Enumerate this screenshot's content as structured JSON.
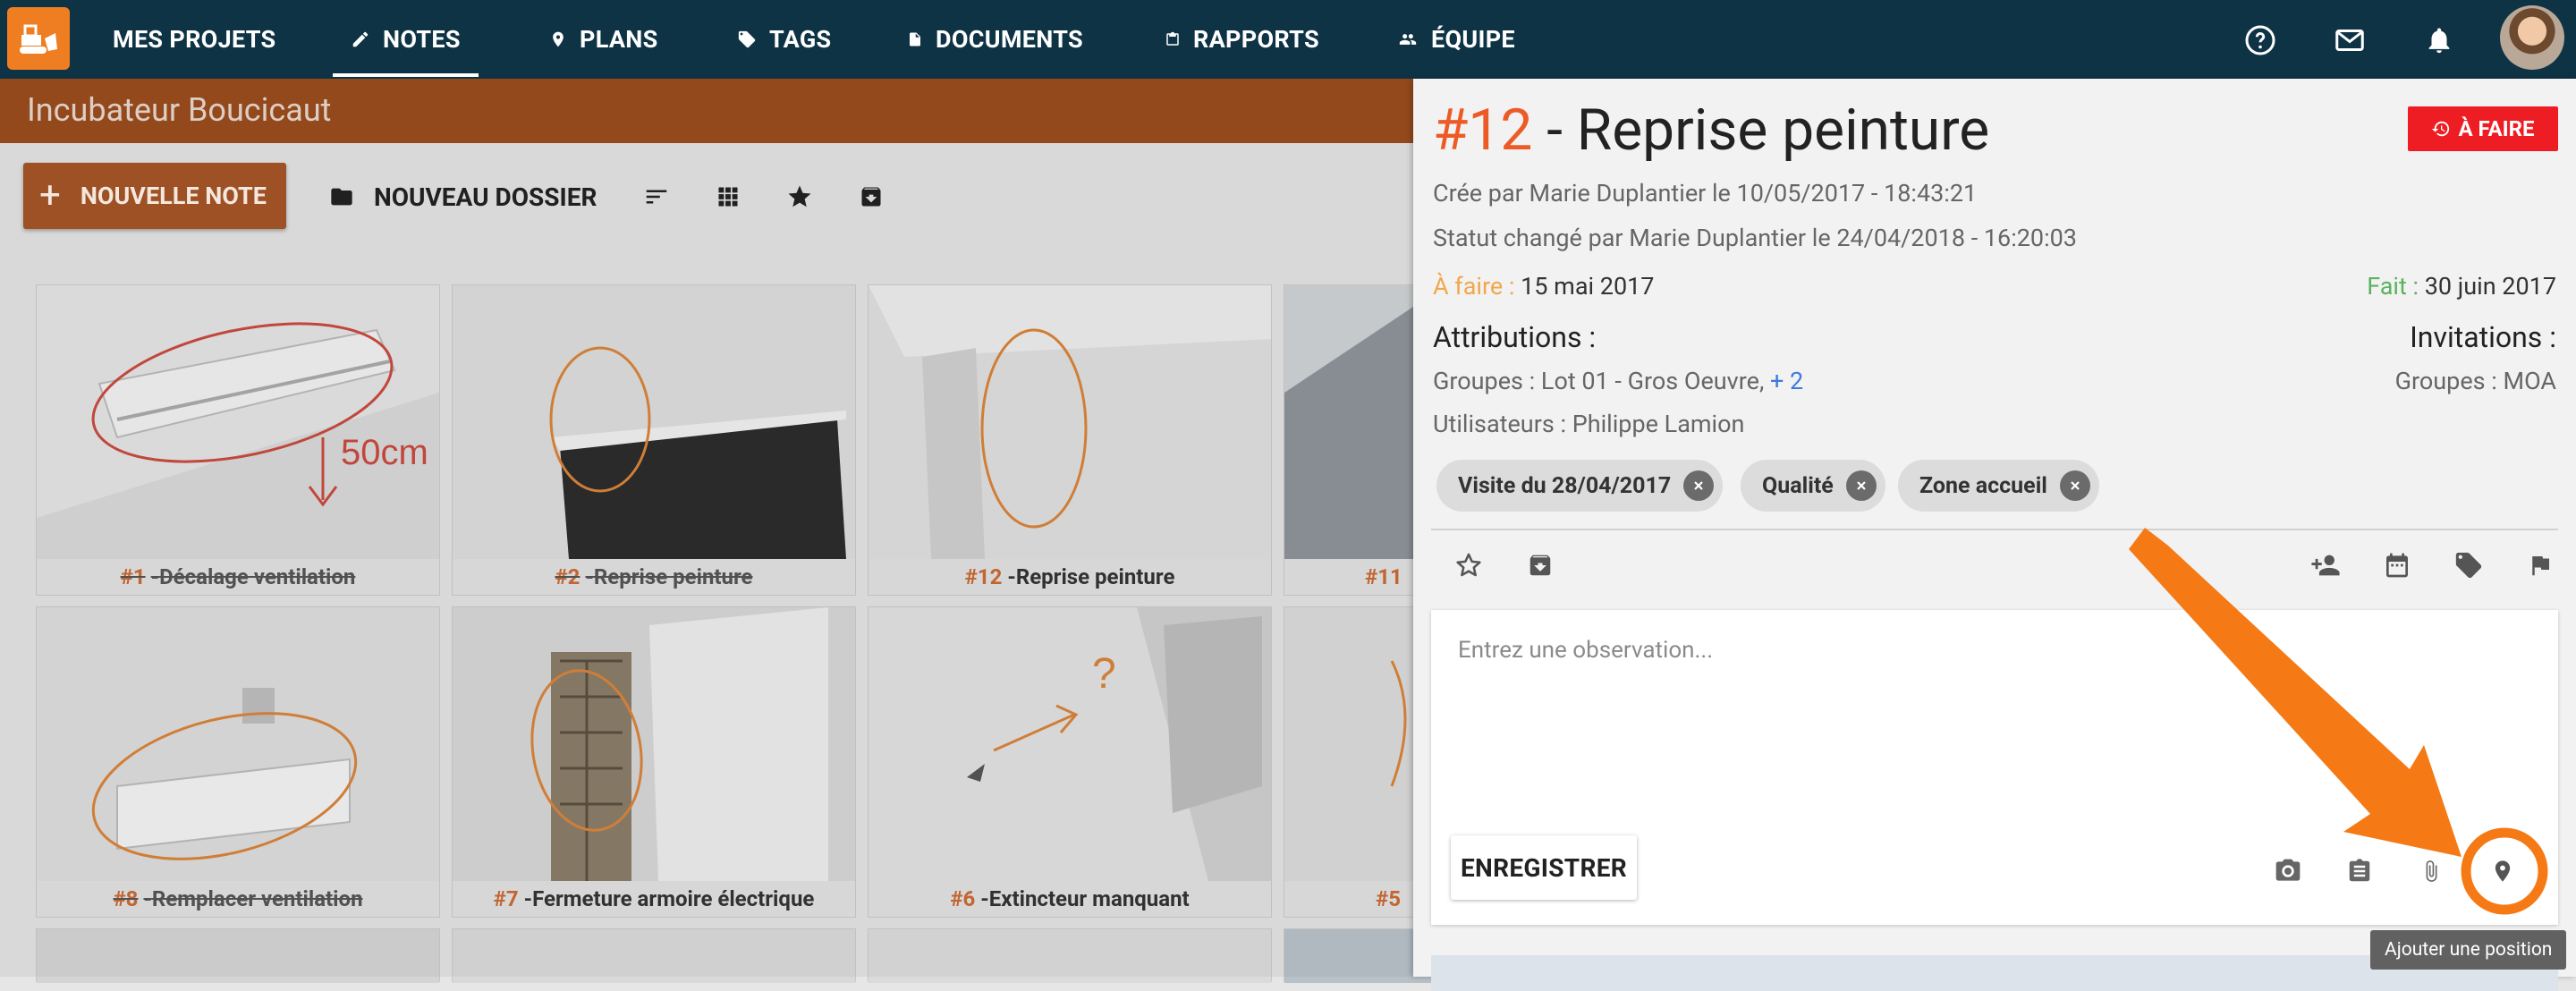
{
  "nav": {
    "my_projects": "MES PROJETS",
    "tabs": [
      {
        "label": "NOTES",
        "icon": "pencil-icon"
      },
      {
        "label": "PLANS",
        "icon": "map-pin-icon"
      },
      {
        "label": "TAGS",
        "icon": "tag-icon"
      },
      {
        "label": "DOCUMENTS",
        "icon": "document-icon"
      },
      {
        "label": "RAPPORTS",
        "icon": "clipboard-icon"
      },
      {
        "label": "ÉQUIPE",
        "icon": "people-icon"
      }
    ],
    "active_tab": "NOTES",
    "right_icons": [
      "help-icon",
      "mail-icon",
      "bell-icon",
      "avatar"
    ]
  },
  "project": {
    "name": "Incubateur Boucicaut"
  },
  "toolbar": {
    "new_note_label": "NOUVELLE NOTE",
    "new_folder_label": "NOUVEAU DOSSIER",
    "icons": [
      "sort-icon",
      "grid-view-icon",
      "star-icon",
      "archive-icon"
    ]
  },
  "notes": [
    {
      "num": "#1",
      "sep": " - ",
      "title": "Décalage ventilation",
      "done": true
    },
    {
      "num": "#2",
      "sep": " - ",
      "title": "Reprise peinture",
      "done": true
    },
    {
      "num": "#12",
      "sep": " - ",
      "title": "Reprise peinture",
      "done": false
    },
    {
      "num": "#11",
      "sep": "",
      "title": "",
      "done": false
    },
    {
      "num": "#8",
      "sep": " - ",
      "title": "Remplacer ventilation",
      "done": true
    },
    {
      "num": "#7",
      "sep": " - ",
      "title": "Fermeture armoire électrique",
      "done": false
    },
    {
      "num": "#6",
      "sep": " - ",
      "title": "Extincteur manquant",
      "done": false
    },
    {
      "num": "#5",
      "sep": "",
      "title": "",
      "done": false
    }
  ],
  "panel": {
    "num": "#12",
    "title": " - Reprise peinture",
    "status": "À FAIRE",
    "created": "Crée par Marie Duplantier le 10/05/2017 - 18:43:21",
    "status_changed": "Statut changé par Marie Duplantier le 24/04/2018 - 16:20:03",
    "todo_label": "À faire :",
    "todo_date": "15 mai 2017",
    "done_label": "Fait :",
    "done_date": "30 juin 2017",
    "attributions_title": "Attributions :",
    "invitations_title": "Invitations :",
    "groups_text": "Groupes : Lot 01 - Gros Oeuvre,",
    "groups_more": "+ 2",
    "users_text": "Utilisateurs : Philippe Lamion",
    "inv_groups_text": "Groupes : MOA",
    "chips": [
      "Visite du 28/04/2017",
      "Qualité",
      "Zone accueil"
    ],
    "action_icons": [
      "star-icon",
      "archive-icon",
      "add-person-icon",
      "calendar-icon",
      "tag-icon",
      "flag-icon"
    ],
    "observation_placeholder": "Entrez une observation...",
    "save_label": "ENREGISTRER",
    "obs_icons": [
      "camera-icon",
      "clipboard-icon",
      "paperclip-icon",
      "location-pin-icon"
    ],
    "tooltip": "Ajouter une position"
  },
  "colors": {
    "topbar": "#0e3345",
    "accent": "#ef7d22",
    "status_red": "#ee1d23",
    "todo_orange": "#f2a74a",
    "done_green": "#5bb35f",
    "note_number": "#ec5b25"
  }
}
